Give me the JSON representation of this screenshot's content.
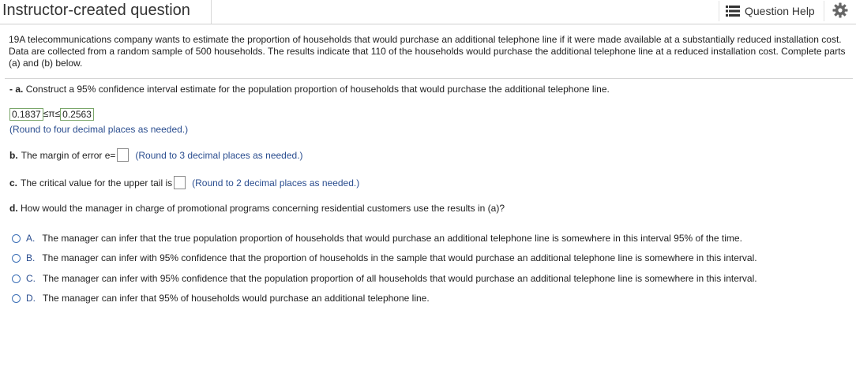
{
  "header": {
    "title": "Instructor-created question",
    "help_label": "Question Help"
  },
  "problem": {
    "text": "19A telecommunications company wants to estimate the proportion of households that would purchase an additional telephone line if it were made available at a substantially reduced installation cost. Data are collected from a random sample of 500 households. The results indicate that 110 of the households would purchase the additional telephone line at a reduced installation cost. Complete parts (a) and (b) below."
  },
  "part_a": {
    "prefix": "- a.",
    "text": "Construct a 95% confidence interval estimate for the population proportion of households that would purchase the additional telephone line.",
    "lower": "0.1837",
    "relation": "≤π≤",
    "upper": "0.2563",
    "hint": "(Round to four decimal places as needed.)"
  },
  "part_b": {
    "prefix": "b.",
    "text": "The margin of error e=",
    "hint": "(Round to 3 decimal places as needed.)"
  },
  "part_c": {
    "prefix": "c.",
    "text": "The critical value for the upper tail is",
    "hint": "(Round to 2 decimal places as needed.)"
  },
  "part_d": {
    "prefix": "d.",
    "text": "How would the manager in charge of promotional programs concerning residential customers use the results in (a)?"
  },
  "options": [
    {
      "letter": "A.",
      "text": "The manager can infer that the true population proportion of households that would purchase an additional telephone line is somewhere in this interval 95% of the time."
    },
    {
      "letter": "B.",
      "text": "The manager can infer with 95% confidence that the proportion of households in the sample that would purchase an additional telephone line is somewhere in this interval."
    },
    {
      "letter": "C.",
      "text": "The manager can infer with 95% confidence that the population proportion of all households that would purchase an additional telephone line is somewhere in this interval."
    },
    {
      "letter": "D.",
      "text": "The manager can infer that 95% of households would purchase an additional telephone line."
    }
  ],
  "colors": {
    "hint_blue": "#2a4d8f",
    "radio_blue": "#3b6fb6",
    "answer_border": "#7aa66a"
  }
}
